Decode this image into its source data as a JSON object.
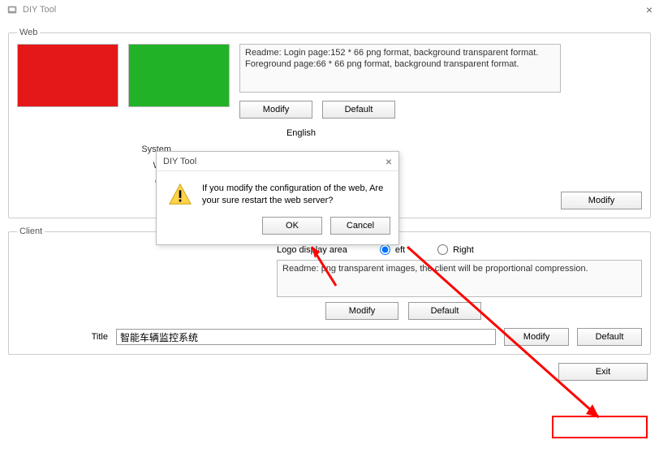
{
  "window": {
    "title": "DIY Tool",
    "close": "×"
  },
  "web": {
    "legend": "Web",
    "readme_line1": "Readme: Login page:152 * 66 png format, background transparent format.",
    "readme_line2": "Foreground page:66 * 66 png format, background transparent format.",
    "modify": "Modify",
    "default": "Default",
    "lang_header": "English",
    "labels": {
      "system": "System",
      "web": "Web",
      "cop": "Cop"
    },
    "modify2": "Modify"
  },
  "dialog": {
    "title": "DIY Tool",
    "close": "×",
    "message": "If you modify the configuration of the web, Are your sure restart the web server?",
    "ok": "OK",
    "cancel": "Cancel"
  },
  "client": {
    "legend": "Client",
    "logo_label": "Logo display area",
    "left": "eft",
    "right": "Right",
    "readme": "Readme: png transparent images, the client will be proportional compression.",
    "modify": "Modify",
    "default": "Default",
    "title_label": "Title",
    "title_value": "智能车辆监控系统",
    "title_modify": "Modify",
    "title_default": "Default"
  },
  "footer": {
    "exit": "Exit"
  }
}
